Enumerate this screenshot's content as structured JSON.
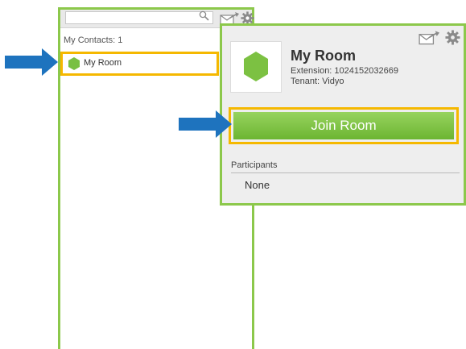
{
  "contacts": {
    "search_placeholder": "",
    "count_label": "My Contacts: 1",
    "items": [
      {
        "label": "My Room",
        "icon": "room-hexagon-icon"
      }
    ]
  },
  "room": {
    "title": "My Room",
    "extension": "Extension: 1024152032669",
    "tenant": "Tenant: Vidyo",
    "join_label": "Join Room",
    "participants_heading": "Participants",
    "participants_empty": "None"
  },
  "colors": {
    "panel_border": "#8cc84b",
    "highlight": "#f5b800",
    "arrow": "#1e73be",
    "join_button": "#7cc142"
  },
  "icons": [
    "search-icon",
    "invite-icon",
    "gear-icon",
    "room-hexagon-icon",
    "arrow-right-icon"
  ]
}
